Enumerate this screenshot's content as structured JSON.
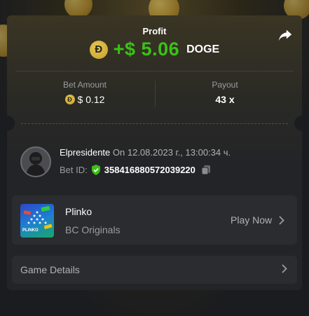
{
  "profit": {
    "title": "Profit",
    "coin_symbol": "Đ",
    "amount": "+$ 5.06",
    "currency": "DOGE"
  },
  "bet_amount": {
    "label": "Bet Amount",
    "coin_symbol": "Đ",
    "value": "$ 0.12"
  },
  "payout": {
    "label": "Payout",
    "value": "43 x"
  },
  "user": {
    "name": "Elpresidente",
    "date": "On 12.08.2023 г., 13:00:34 ч.",
    "bet_id_label": "Bet ID:",
    "bet_id": "358416880572039220"
  },
  "game": {
    "name": "Plinko",
    "provider": "BC Originals",
    "play_label": "Play Now",
    "thumb_label": "PLINKO"
  },
  "details": {
    "label": "Game Details"
  },
  "colors": {
    "profit_green": "#3bc117",
    "doge_gold": "#c5a02d",
    "shield_green": "#3bc117"
  },
  "icons": [
    "share-icon",
    "doge-coin-icon",
    "shield-check-icon",
    "copy-icon",
    "chevron-right-icon"
  ]
}
